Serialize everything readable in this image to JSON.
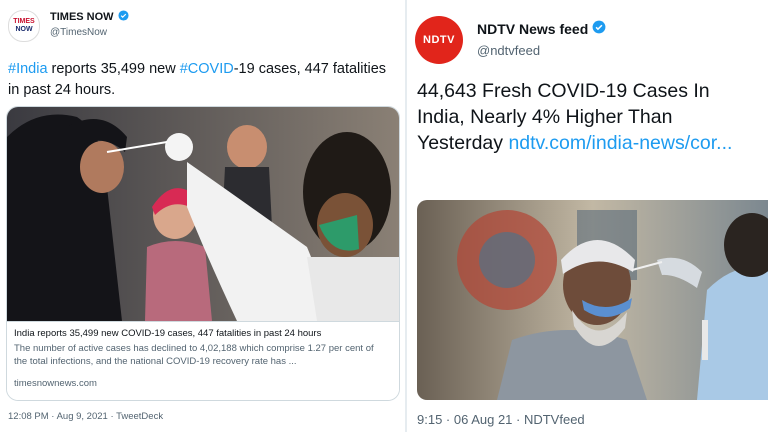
{
  "left_tweet": {
    "name": "TIMES NOW",
    "handle": "@TimesNow",
    "avatar_text_1": "TIMES",
    "avatar_text_2": "NOW",
    "text_tag1": "#India",
    "text_part1": " reports 35,499 new ",
    "text_tag2": "#COVID",
    "text_part2": "-19 cases, 447 fatalities in past 24 hours.",
    "card": {
      "title": "India reports 35,499 new COVID-19 cases, 447 fatalities in past 24 hours",
      "description": "The number of active cases has declined to 4,02,188 which comprise 1.27 per cent of the total infections, and the national COVID-19 recovery rate has ...",
      "domain": "timesnownews.com"
    },
    "timestamp": "12:08 PM · Aug 9, 2021 · TweetDeck"
  },
  "right_tweet": {
    "name": "NDTV News feed",
    "handle": "@ndtvfeed",
    "avatar_text": "NDTV",
    "text_main": "44,643 Fresh COVID-19 Cases In India, Nearly 4% Higher Than Yesterday ",
    "text_link": "ndtv.com/india-news/cor...",
    "timestamp": "9:15 · 06 Aug 21 · NDTVfeed"
  },
  "colors": {
    "link": "#1d9bf0",
    "verified": "#1d9bf0",
    "ndtv_red": "#e1251b"
  }
}
